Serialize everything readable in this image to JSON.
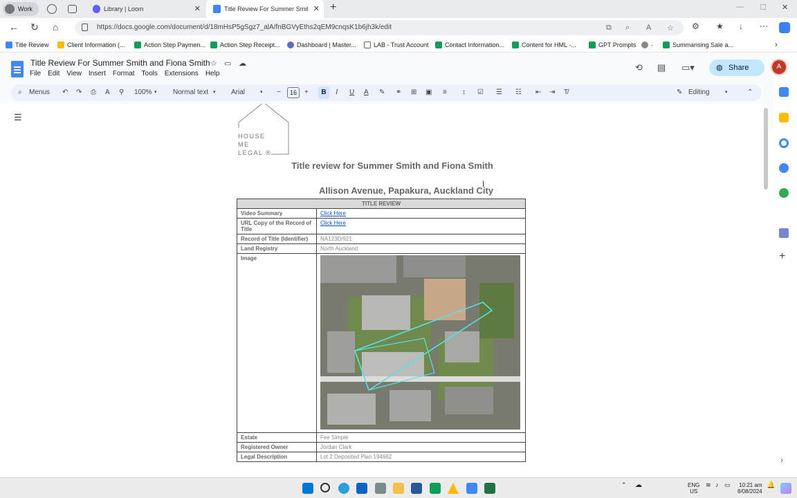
{
  "browser": {
    "profile_label": "Work",
    "tabs": [
      {
        "title": "Library | Loom",
        "active": false
      },
      {
        "title": "Title Review For Summer Smith a",
        "active": true
      }
    ],
    "url": "https://docs.google.com/document/d/18mHsP5gSgz7_alA/fnBGVyEths2qEM9cnqsK1b6jh3k/edit",
    "bookmarks": [
      "Title Review",
      "Client Information (...",
      "Action Step Paymen...",
      "Action Step Receipt...",
      "Dashboard | Master...",
      "LAB - Trust Account",
      "Contact Information...",
      "Content for HML -...",
      "GPT Prompts",
      "·",
      "Summarising Sale a..."
    ]
  },
  "docs": {
    "title": "Title Review For Summer Smith and Fiona Smith",
    "menu": [
      "File",
      "Edit",
      "View",
      "Insert",
      "Format",
      "Tools",
      "Extensions",
      "Help"
    ],
    "share_label": "Share",
    "account_initial": "A",
    "toolbar": {
      "search_label": "Menus",
      "zoom": "100%",
      "style": "Normal text",
      "font": "Arial",
      "font_size": "16",
      "bold_label": "B",
      "italic_label": "I",
      "underline_label": "U",
      "text_color_label": "A",
      "mode": "Editing"
    }
  },
  "document": {
    "logo_lines": [
      "HOUSE",
      "ME",
      "LEGAL ®"
    ],
    "heading": "Title review for Summer Smith and Fiona Smith",
    "subheading": "Allison Avenue, Papakura, Auckland City",
    "table": {
      "header": "TITLE REVIEW",
      "rows": {
        "video_summary": {
          "label": "Video Summary",
          "value": "Click Here"
        },
        "url_copy": {
          "label": "URL Copy of the Record of Title",
          "value": "Click Here"
        },
        "record": {
          "label": "Record of Title (Identifier)",
          "value": "NA123D/921"
        },
        "registry": {
          "label": "Land Registry",
          "value": "North Auckland"
        },
        "image": {
          "label": "Image"
        },
        "estate": {
          "label": "Estate",
          "value": "Fee Simple"
        },
        "owner": {
          "label": "Registered Owner",
          "value": "Jordan Clark"
        },
        "legal": {
          "label": "Legal Description",
          "value": "Lot 2 Deposited Plan 194662"
        }
      }
    }
  },
  "taskbar": {
    "lang_top": "ENG",
    "lang_bottom": "US",
    "time": "10:21 am",
    "date": "8/08/2024"
  },
  "colors": {
    "accent": "#1a73e8",
    "share_bg": "#c2e7ff",
    "docs_bg": "#f9fbfd",
    "toolbar_bg": "#edf2fa",
    "link": "#1155cc"
  }
}
